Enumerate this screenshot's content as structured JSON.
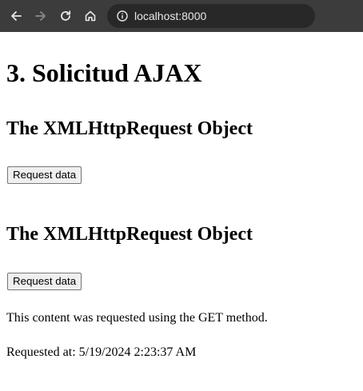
{
  "browser": {
    "url": "localhost:8000"
  },
  "page": {
    "title": "3. Solicitud AJAX",
    "sections": [
      {
        "heading": "The XMLHttpRequest Object",
        "button_label": "Request data"
      },
      {
        "heading": "The XMLHttpRequest Object",
        "button_label": "Request data"
      }
    ],
    "result": {
      "message": "This content was requested using the GET method.",
      "timestamp": "Requested at: 5/19/2024 2:23:37 AM"
    }
  },
  "colors": {
    "toolbar_bg": "#3c3c3c",
    "urlbar_bg": "#282828",
    "icon_active": "#e8e8e8",
    "icon_disabled": "#8a8a8a"
  },
  "icons": [
    "back-arrow-icon",
    "forward-arrow-icon",
    "reload-icon",
    "home-icon",
    "info-icon"
  ]
}
